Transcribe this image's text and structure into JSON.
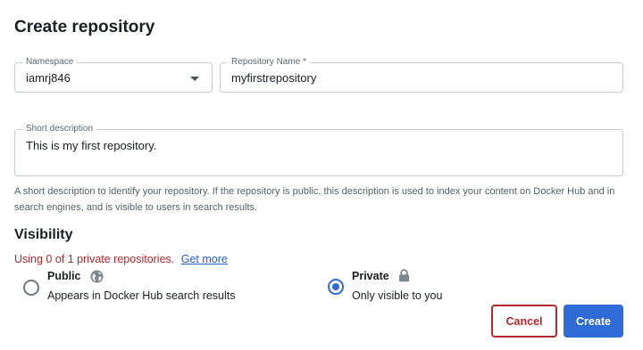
{
  "page_title": "Create repository",
  "namespace": {
    "label": "Namespace",
    "value": "iamrj846"
  },
  "repository_name": {
    "label": "Repository Name *",
    "value": "myfirstrepository"
  },
  "short_description": {
    "label": "Short description",
    "value": "This is my first repository.",
    "helper": "A short description to identify your repository. If the repository is public, this description is used to index your content on Docker Hub and in search engines, and is visible to users in search results."
  },
  "visibility": {
    "title": "Visibility",
    "usage_text": "Using 0 of 1 private repositories.",
    "usage_link": "Get more",
    "selected": "private",
    "options": {
      "public": {
        "title": "Public",
        "description": "Appears in Docker Hub search results",
        "icon": "globe-icon"
      },
      "private": {
        "title": "Private",
        "description": "Only visible to you",
        "icon": "lock-icon"
      }
    }
  },
  "actions": {
    "cancel_label": "Cancel",
    "create_label": "Create"
  },
  "colors": {
    "accent": "#2f6bd6",
    "danger": "#b3282d",
    "link": "#2560c9"
  }
}
